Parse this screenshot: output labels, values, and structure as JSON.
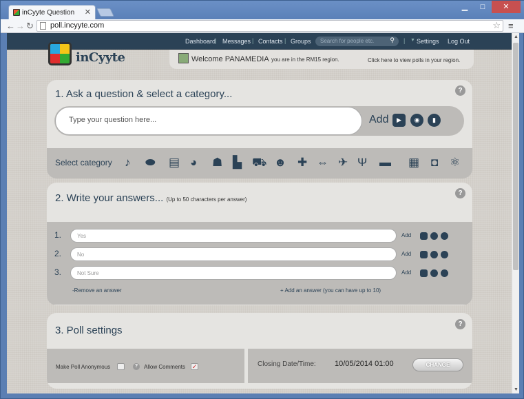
{
  "browser": {
    "tab_title": "inCyyte Question",
    "url": "poll.incyyte.com"
  },
  "nav": {
    "dashboard": "Dashboard",
    "messages": "Messages",
    "contacts": "Contacts",
    "groups": "Groups",
    "search_placeholder": "Search for people etc.",
    "settings": "Settings",
    "logout": "Log Out"
  },
  "brand": {
    "name": "inCyyte"
  },
  "welcome": {
    "greeting": "Welcome PANAMEDIA",
    "region": "you are in the RM15 region.",
    "link": "Click here to view polls in your region."
  },
  "section1": {
    "title": "1. Ask a question & select a category...",
    "question_placeholder": "Type your question here...",
    "add_label": "Add",
    "category_label": "Select category",
    "categories": [
      "music-icon",
      "sports-icon",
      "books-icon",
      "chat-icon",
      "people-icon",
      "industry-icon",
      "shopping-icon",
      "relationships-icon",
      "health-icon",
      "fitness-icon",
      "travel-icon",
      "food-icon",
      "cars-icon",
      "technology-icon",
      "gaming-icon",
      "science-icon"
    ]
  },
  "section2": {
    "title": "2. Write your answers...",
    "subtitle": "(Up to 50 characters per answer)",
    "answers": [
      {
        "num": "1.",
        "placeholder": "Yes"
      },
      {
        "num": "2.",
        "placeholder": "No"
      },
      {
        "num": "3.",
        "placeholder": "Not Sure"
      }
    ],
    "add_label": "Add",
    "remove_link": "-Remove an answer",
    "add_link": "+ Add an answer (you can have up to 10)"
  },
  "section3": {
    "title": "3. Poll settings",
    "anonymous_label": "Make Poll Anonymous",
    "comments_label": "Allow Comments",
    "closing_label": "Closing Date/Time:",
    "closing_value": "10/05/2014 01:00",
    "change_label": "CHANGE"
  },
  "colors": {
    "navy": "#2b4256",
    "panel": "#e5e4e1",
    "band": "#bdbbb8"
  }
}
